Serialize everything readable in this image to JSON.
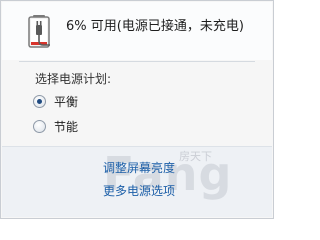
{
  "battery": {
    "status_text": "6% 可用(电源已接通，未充电)",
    "level": 0.06,
    "icon": "battery-plugged-icon",
    "colors": {
      "low_fill": "#d8342c",
      "plug": "#5a5a5a"
    }
  },
  "power_plan": {
    "section_label": "选择电源计划:",
    "options": [
      {
        "label": "平衡",
        "selected": true
      },
      {
        "label": "节能",
        "selected": false
      }
    ]
  },
  "links": {
    "adjust_brightness": "调整屏幕亮度",
    "more_options": "更多电源选项"
  },
  "watermark": {
    "text": "Fang",
    "small": "房天下"
  },
  "colors": {
    "link": "#1c5fa8",
    "radio_dot": "#1f4a80"
  }
}
